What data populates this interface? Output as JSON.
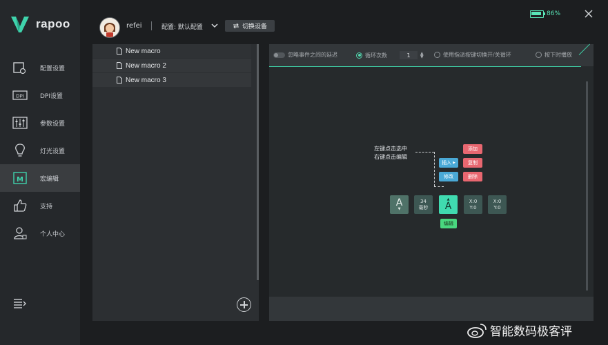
{
  "app": {
    "name": "rapoo"
  },
  "header": {
    "username": "refei",
    "config_label": "配置: 默认配置",
    "switch_button": "切换设备",
    "battery_text": "86%",
    "battery_level": 0.86
  },
  "sidebar": {
    "items": [
      {
        "label": "配置设置",
        "icon": "config-icon"
      },
      {
        "label": "DPI设置",
        "icon": "dpi-icon"
      },
      {
        "label": "参数设置",
        "icon": "sliders-icon"
      },
      {
        "label": "灯光设置",
        "icon": "bulb-icon"
      },
      {
        "label": "宏编辑",
        "icon": "macro-icon",
        "active": true
      },
      {
        "label": "支持",
        "icon": "thumbs-up-icon"
      },
      {
        "label": "个人中心",
        "icon": "user-icon"
      }
    ]
  },
  "macros": {
    "items": [
      "New macro",
      "New macro 2",
      "New macro 3"
    ]
  },
  "editor": {
    "toolbar": {
      "ignore_delay": "忽略事件之间的延迟",
      "loop_count_label": "循环次数",
      "loop_count_value": "1",
      "toggle_option": "使用指派按键切换开/关循环",
      "hold_option": "按下时播放"
    },
    "hint_line1": "左键点击选中",
    "hint_line2": "右键点击编辑",
    "menu": {
      "insert": "插入",
      "add": "添加",
      "modify": "修改",
      "copy": "复制",
      "delete": "删除",
      "edit": "编辑"
    },
    "sequence": {
      "key1": "A",
      "delay_value": "34",
      "delay_unit": "毫秒",
      "key2": "A",
      "coords1_x": "X:0",
      "coords1_y": "Y:0",
      "coords2_x": "X:0",
      "coords2_y": "Y:0"
    }
  },
  "watermark": "智能数码极客评",
  "colors": {
    "accent": "#3ecfa5",
    "battery": "#59e6b8",
    "red": "#e86770",
    "blue": "#4aa9d6",
    "green": "#49d77f"
  }
}
